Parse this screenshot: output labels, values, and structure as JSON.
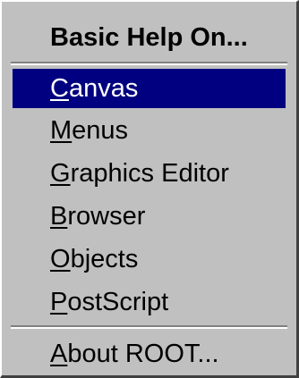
{
  "menu": {
    "title": "Basic Help On...",
    "items": [
      {
        "mnemonic": "C",
        "rest": "anvas",
        "selected": true
      },
      {
        "mnemonic": "M",
        "rest": "enus",
        "selected": false
      },
      {
        "mnemonic": "G",
        "rest": "raphics Editor",
        "selected": false
      },
      {
        "mnemonic": "B",
        "rest": "rowser",
        "selected": false
      },
      {
        "mnemonic": "O",
        "rest": "bjects",
        "selected": false
      },
      {
        "mnemonic": "P",
        "rest": "ostScript",
        "selected": false
      }
    ],
    "footer_item": {
      "mnemonic": "A",
      "rest": "bout ROOT..."
    }
  },
  "colors": {
    "menu_background": "#c0c0c0",
    "selection_background": "#000080",
    "selection_text": "#ffffff"
  }
}
